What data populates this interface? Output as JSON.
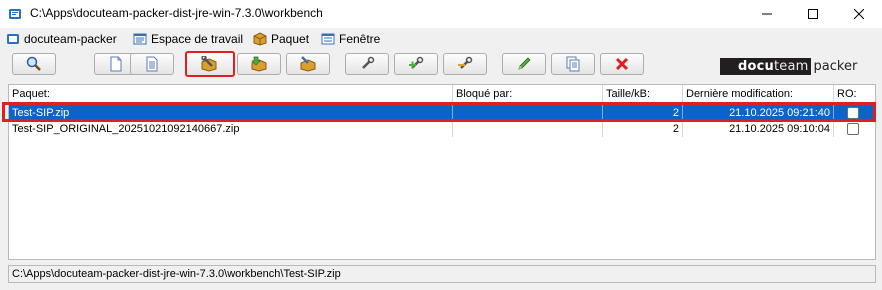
{
  "window": {
    "title": "C:\\Apps\\docuteam-packer-dist-jre-win-7.3.0\\workbench"
  },
  "menu": {
    "items": [
      {
        "label": "docuteam-packer",
        "icon": "app-icon"
      },
      {
        "label": "Espace de travail",
        "icon": "workspace-icon"
      },
      {
        "label": "Paquet",
        "icon": "package-icon"
      },
      {
        "label": "Fenêtre",
        "icon": "window-icon"
      }
    ]
  },
  "toolbar": {
    "buttons": [
      {
        "name": "search-button",
        "icon": "magnifier-icon"
      },
      {
        "name": "new-document-button",
        "icon": "blank-document-icon"
      },
      {
        "name": "view-document-button",
        "icon": "document-lines-icon"
      },
      {
        "name": "open-package-button",
        "icon": "package-wrench-icon",
        "active": true
      },
      {
        "name": "package-download-button",
        "icon": "package-down-icon"
      },
      {
        "name": "package-edit-button",
        "icon": "package-edit-icon"
      },
      {
        "name": "tool-button",
        "icon": "wrench-icon"
      },
      {
        "name": "tool-add-button",
        "icon": "wrench-plus-icon"
      },
      {
        "name": "tool-remove-button",
        "icon": "wrench-minus-icon"
      },
      {
        "name": "edit-button",
        "icon": "pencil-icon"
      },
      {
        "name": "copy-button",
        "icon": "copy-documents-icon"
      },
      {
        "name": "delete-button",
        "icon": "red-x-icon"
      }
    ],
    "logo": {
      "dark_bold": "docu",
      "dark_rest": "team",
      "light": "packer"
    }
  },
  "table": {
    "headers": [
      "Paquet:",
      "Bloqué par:",
      "Taille/kB:",
      "Dernière modification:",
      "RO:"
    ],
    "rows": [
      {
        "name": "Test-SIP.zip",
        "locked_by": "",
        "size": "2",
        "modified": "21.10.2025 09:21:40",
        "readonly": false,
        "selected": true
      },
      {
        "name": "Test-SIP_ORIGINAL_20251021092140667.zip",
        "locked_by": "",
        "size": "2",
        "modified": "21.10.2025 09:10:04",
        "readonly": false,
        "selected": false
      }
    ]
  },
  "status": {
    "path": "C:\\Apps\\docuteam-packer-dist-jre-win-7.3.0\\workbench\\Test-SIP.zip"
  },
  "colors": {
    "selection": "#0b64c7",
    "highlight_outline": "#e02020"
  }
}
